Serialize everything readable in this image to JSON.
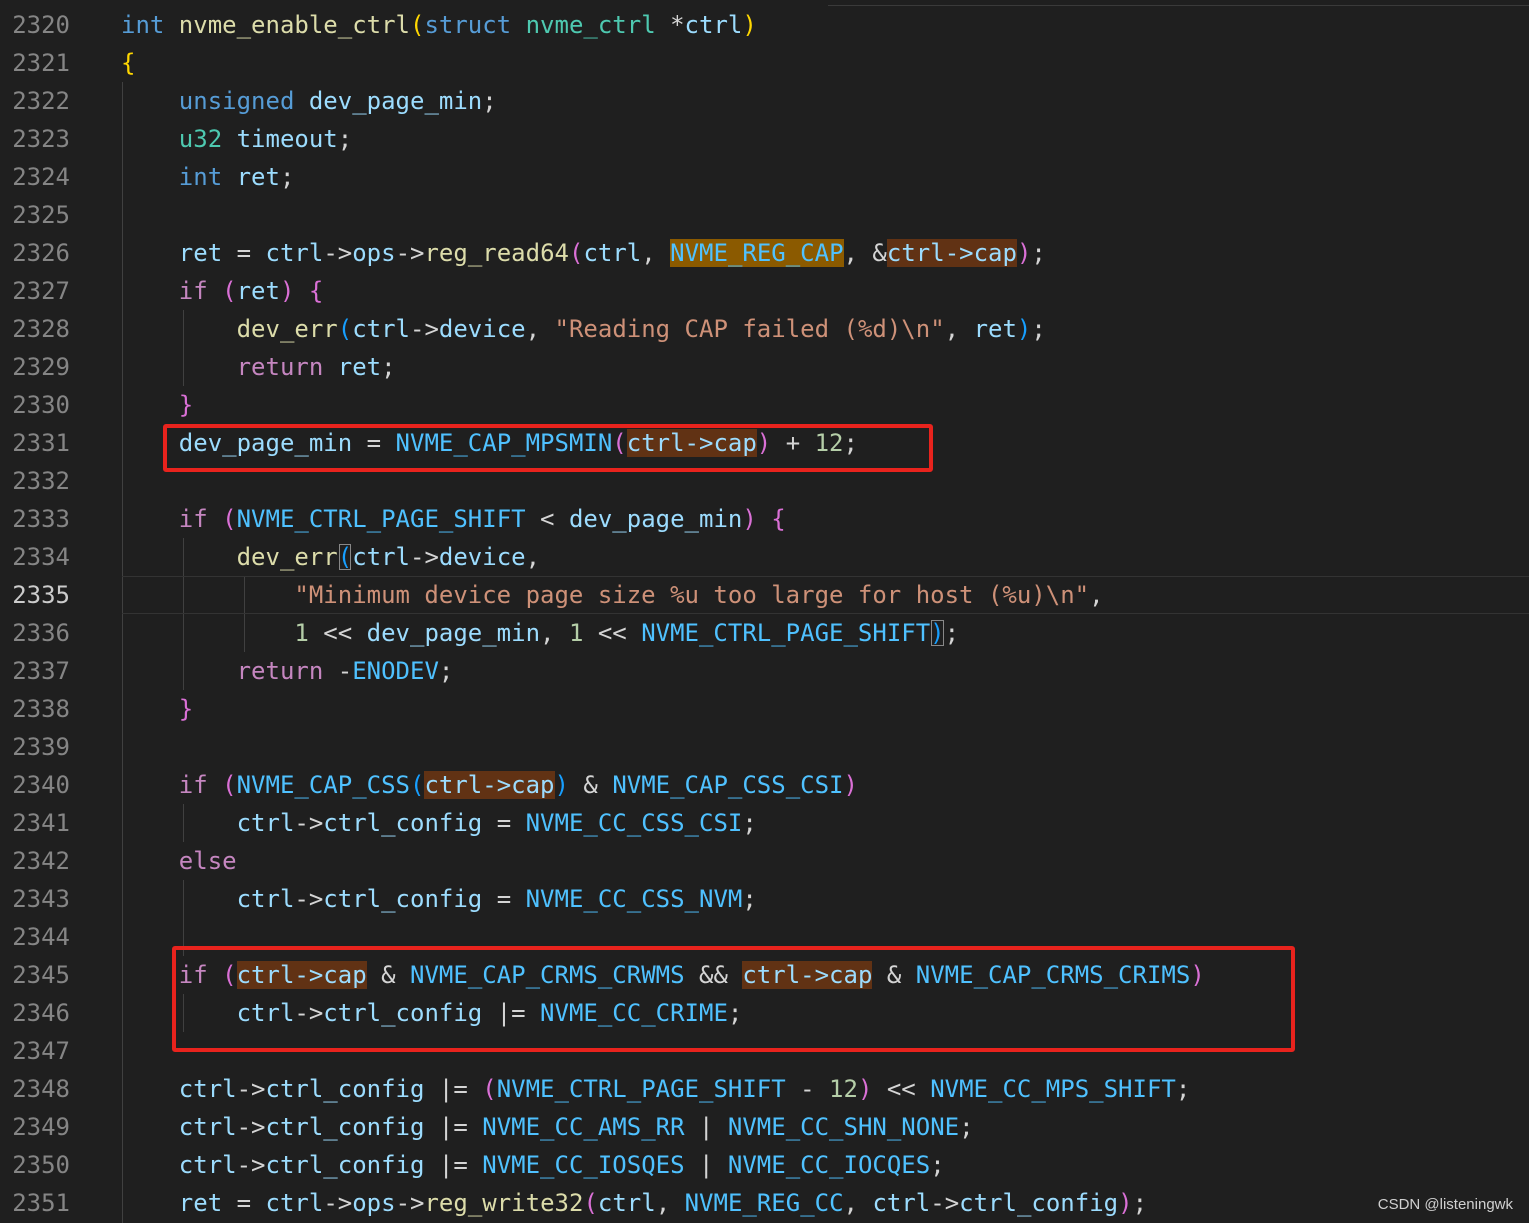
{
  "editor": {
    "lines": [
      {
        "n": "2320",
        "t": [
          [
            "int ",
            "kw"
          ],
          [
            "nvme_enable_ctrl",
            "fn"
          ],
          [
            "(",
            "b1"
          ],
          [
            "struct ",
            "kw"
          ],
          [
            "nvme_ctrl ",
            "ty"
          ],
          [
            "*",
            "op"
          ],
          [
            "ctrl",
            "var"
          ],
          [
            ")",
            "b1"
          ]
        ]
      },
      {
        "n": "2321",
        "t": [
          [
            "{",
            "b1"
          ]
        ]
      },
      {
        "n": "2322",
        "t": [
          [
            "    ",
            ""
          ],
          [
            "unsigned ",
            "kw"
          ],
          [
            "dev_page_min",
            "var"
          ],
          [
            ";",
            "op"
          ]
        ]
      },
      {
        "n": "2323",
        "t": [
          [
            "    ",
            ""
          ],
          [
            "u32 ",
            "ty"
          ],
          [
            "timeout",
            "var"
          ],
          [
            ";",
            "op"
          ]
        ]
      },
      {
        "n": "2324",
        "t": [
          [
            "    ",
            ""
          ],
          [
            "int ",
            "kw"
          ],
          [
            "ret",
            "var"
          ],
          [
            ";",
            "op"
          ]
        ]
      },
      {
        "n": "2325",
        "t": []
      },
      {
        "n": "2326",
        "t": [
          [
            "    ",
            ""
          ],
          [
            "ret",
            "var"
          ],
          [
            " = ",
            "op"
          ],
          [
            "ctrl",
            "var"
          ],
          [
            "->",
            "op"
          ],
          [
            "ops",
            "var"
          ],
          [
            "->",
            "op"
          ],
          [
            "reg_read64",
            "fn"
          ],
          [
            "(",
            "b2"
          ],
          [
            "ctrl",
            "var"
          ],
          [
            ", ",
            "op"
          ],
          [
            "NVME_REG_CAP",
            "mac hlb"
          ],
          [
            ", &",
            "op"
          ],
          [
            "ctrl->cap",
            "var hl"
          ],
          [
            ")",
            "b2"
          ],
          [
            ";",
            "op"
          ]
        ]
      },
      {
        "n": "2327",
        "t": [
          [
            "    ",
            ""
          ],
          [
            "if ",
            "ctl"
          ],
          [
            "(",
            "b2"
          ],
          [
            "ret",
            "var"
          ],
          [
            ") ",
            "b2"
          ],
          [
            "{",
            "b2"
          ]
        ]
      },
      {
        "n": "2328",
        "t": [
          [
            "        ",
            ""
          ],
          [
            "dev_err",
            "fn"
          ],
          [
            "(",
            "b3"
          ],
          [
            "ctrl",
            "var"
          ],
          [
            "->",
            "op"
          ],
          [
            "device",
            "var"
          ],
          [
            ", ",
            "op"
          ],
          [
            "\"Reading CAP failed (%d)\\n\"",
            "str"
          ],
          [
            ", ",
            "op"
          ],
          [
            "ret",
            "var"
          ],
          [
            ")",
            "b3"
          ],
          [
            ";",
            "op"
          ]
        ]
      },
      {
        "n": "2329",
        "t": [
          [
            "        ",
            ""
          ],
          [
            "return ",
            "ctl"
          ],
          [
            "ret",
            "var"
          ],
          [
            ";",
            "op"
          ]
        ]
      },
      {
        "n": "2330",
        "t": [
          [
            "    ",
            ""
          ],
          [
            "}",
            "b2"
          ]
        ]
      },
      {
        "n": "2331",
        "t": [
          [
            "    ",
            ""
          ],
          [
            "dev_page_min",
            "var"
          ],
          [
            " = ",
            "op"
          ],
          [
            "NVME_CAP_MPSMIN",
            "mac"
          ],
          [
            "(",
            "b2"
          ],
          [
            "ctrl->cap",
            "var hl"
          ],
          [
            ")",
            "b2"
          ],
          [
            " + ",
            "op"
          ],
          [
            "12",
            "num"
          ],
          [
            ";",
            "op"
          ]
        ]
      },
      {
        "n": "2332",
        "t": []
      },
      {
        "n": "2333",
        "t": [
          [
            "    ",
            ""
          ],
          [
            "if ",
            "ctl"
          ],
          [
            "(",
            "b2"
          ],
          [
            "NVME_CTRL_PAGE_SHIFT",
            "mac"
          ],
          [
            " < ",
            "op"
          ],
          [
            "dev_page_min",
            "var"
          ],
          [
            ") ",
            "b2"
          ],
          [
            "{",
            "b2"
          ]
        ]
      },
      {
        "n": "2334",
        "t": [
          [
            "        ",
            ""
          ],
          [
            "dev_err",
            "fn"
          ],
          [
            "(",
            "b3 bm"
          ],
          [
            "ctrl",
            "var"
          ],
          [
            "->",
            "op"
          ],
          [
            "device",
            "var"
          ],
          [
            ",",
            "op"
          ]
        ]
      },
      {
        "n": "2335",
        "t": [
          [
            "            ",
            ""
          ],
          [
            "\"Minimum device page size %u too large for host (%u)\\n\"",
            "str"
          ],
          [
            ",",
            "op"
          ]
        ],
        "current": true
      },
      {
        "n": "2336",
        "t": [
          [
            "            ",
            ""
          ],
          [
            "1",
            "num"
          ],
          [
            " << ",
            "op"
          ],
          [
            "dev_page_min",
            "var"
          ],
          [
            ", ",
            "op"
          ],
          [
            "1",
            "num"
          ],
          [
            " << ",
            "op"
          ],
          [
            "NVME_CTRL_PAGE_SHIFT",
            "mac"
          ],
          [
            ")",
            "b3 bm"
          ],
          [
            ";",
            "op"
          ]
        ]
      },
      {
        "n": "2337",
        "t": [
          [
            "        ",
            ""
          ],
          [
            "return ",
            "ctl"
          ],
          [
            "-",
            "op"
          ],
          [
            "ENODEV",
            "mac"
          ],
          [
            ";",
            "op"
          ]
        ]
      },
      {
        "n": "2338",
        "t": [
          [
            "    ",
            ""
          ],
          [
            "}",
            "b2"
          ]
        ]
      },
      {
        "n": "2339",
        "t": []
      },
      {
        "n": "2340",
        "t": [
          [
            "    ",
            ""
          ],
          [
            "if ",
            "ctl"
          ],
          [
            "(",
            "b2"
          ],
          [
            "NVME_CAP_CSS",
            "mac"
          ],
          [
            "(",
            "b3"
          ],
          [
            "ctrl->cap",
            "var hl"
          ],
          [
            ")",
            "b3"
          ],
          [
            " & ",
            "op"
          ],
          [
            "NVME_CAP_CSS_CSI",
            "mac"
          ],
          [
            ")",
            "b2"
          ]
        ]
      },
      {
        "n": "2341",
        "t": [
          [
            "        ",
            ""
          ],
          [
            "ctrl",
            "var"
          ],
          [
            "->",
            "op"
          ],
          [
            "ctrl_config",
            "var"
          ],
          [
            " = ",
            "op"
          ],
          [
            "NVME_CC_CSS_CSI",
            "mac"
          ],
          [
            ";",
            "op"
          ]
        ]
      },
      {
        "n": "2342",
        "t": [
          [
            "    ",
            ""
          ],
          [
            "else",
            "ctl"
          ]
        ]
      },
      {
        "n": "2343",
        "t": [
          [
            "        ",
            ""
          ],
          [
            "ctrl",
            "var"
          ],
          [
            "->",
            "op"
          ],
          [
            "ctrl_config",
            "var"
          ],
          [
            " = ",
            "op"
          ],
          [
            "NVME_CC_CSS_NVM",
            "mac"
          ],
          [
            ";",
            "op"
          ]
        ]
      },
      {
        "n": "2344",
        "t": []
      },
      {
        "n": "2345",
        "t": [
          [
            "    ",
            ""
          ],
          [
            "if ",
            "ctl"
          ],
          [
            "(",
            "b2"
          ],
          [
            "ctrl->cap",
            "var hl"
          ],
          [
            " & ",
            "op"
          ],
          [
            "NVME_CAP_CRMS_CRWMS",
            "mac"
          ],
          [
            " && ",
            "op"
          ],
          [
            "ctrl->cap",
            "var hl"
          ],
          [
            " & ",
            "op"
          ],
          [
            "NVME_CAP_CRMS_CRIMS",
            "mac"
          ],
          [
            ")",
            "b2"
          ]
        ]
      },
      {
        "n": "2346",
        "t": [
          [
            "        ",
            ""
          ],
          [
            "ctrl",
            "var"
          ],
          [
            "->",
            "op"
          ],
          [
            "ctrl_config",
            "var"
          ],
          [
            " |= ",
            "op"
          ],
          [
            "NVME_CC_CRIME",
            "mac"
          ],
          [
            ";",
            "op"
          ]
        ]
      },
      {
        "n": "2347",
        "t": []
      },
      {
        "n": "2348",
        "t": [
          [
            "    ",
            ""
          ],
          [
            "ctrl",
            "var"
          ],
          [
            "->",
            "op"
          ],
          [
            "ctrl_config",
            "var"
          ],
          [
            " |= ",
            "op"
          ],
          [
            "(",
            "b2"
          ],
          [
            "NVME_CTRL_PAGE_SHIFT",
            "mac"
          ],
          [
            " - ",
            "op"
          ],
          [
            "12",
            "num"
          ],
          [
            ")",
            "b2"
          ],
          [
            " << ",
            "op"
          ],
          [
            "NVME_CC_MPS_SHIFT",
            "mac"
          ],
          [
            ";",
            "op"
          ]
        ]
      },
      {
        "n": "2349",
        "t": [
          [
            "    ",
            ""
          ],
          [
            "ctrl",
            "var"
          ],
          [
            "->",
            "op"
          ],
          [
            "ctrl_config",
            "var"
          ],
          [
            " |= ",
            "op"
          ],
          [
            "NVME_CC_AMS_RR",
            "mac"
          ],
          [
            " | ",
            "op"
          ],
          [
            "NVME_CC_SHN_NONE",
            "mac"
          ],
          [
            ";",
            "op"
          ]
        ]
      },
      {
        "n": "2350",
        "t": [
          [
            "    ",
            ""
          ],
          [
            "ctrl",
            "var"
          ],
          [
            "->",
            "op"
          ],
          [
            "ctrl_config",
            "var"
          ],
          [
            " |= ",
            "op"
          ],
          [
            "NVME_CC_IOSQES",
            "mac"
          ],
          [
            " | ",
            "op"
          ],
          [
            "NVME_CC_IOCQES",
            "mac"
          ],
          [
            ";",
            "op"
          ]
        ]
      },
      {
        "n": "2351",
        "t": [
          [
            "    ",
            ""
          ],
          [
            "ret",
            "var"
          ],
          [
            " = ",
            "op"
          ],
          [
            "ctrl",
            "var"
          ],
          [
            "->",
            "op"
          ],
          [
            "ops",
            "var"
          ],
          [
            "->",
            "op"
          ],
          [
            "reg_write32",
            "fn"
          ],
          [
            "(",
            "b2"
          ],
          [
            "ctrl",
            "var"
          ],
          [
            ", ",
            "op"
          ],
          [
            "NVME_REG_CC",
            "mac"
          ],
          [
            ", ",
            "op"
          ],
          [
            "ctrl",
            "var"
          ],
          [
            "->",
            "op"
          ],
          [
            "ctrl_config",
            "var"
          ],
          [
            ")",
            "b2"
          ],
          [
            ";",
            "op"
          ]
        ]
      }
    ]
  },
  "watermark": "CSDN @listeningwk"
}
